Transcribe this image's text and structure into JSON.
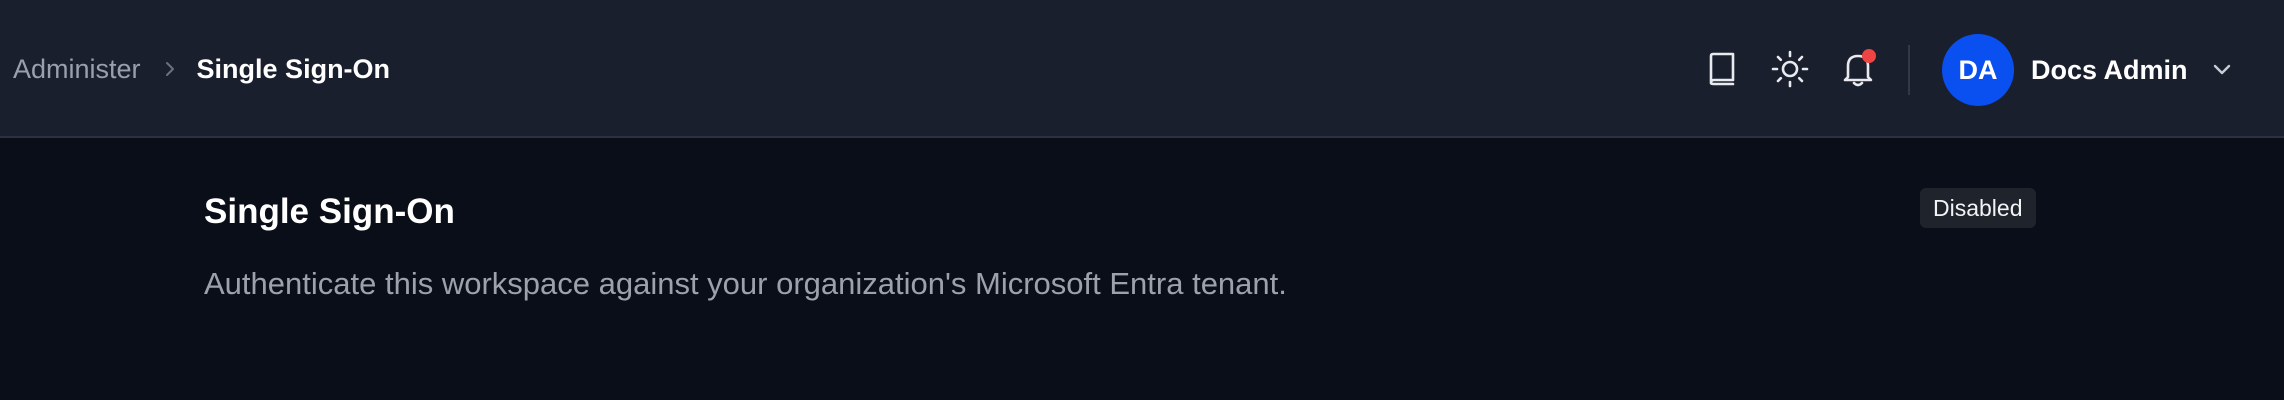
{
  "header": {
    "breadcrumb": {
      "parent": "Administer",
      "current": "Single Sign-On"
    },
    "icons": {
      "docs": "book-icon",
      "theme": "sun-icon",
      "notifications": "bell-icon",
      "notification_dot_color": "#ef4444"
    },
    "user": {
      "initials": "DA",
      "name": "Docs Admin",
      "avatar_color": "#0a4ff0"
    }
  },
  "main": {
    "title": "Single Sign-On",
    "description": "Authenticate this workspace against your organization's Microsoft Entra tenant.",
    "status": "Disabled"
  }
}
